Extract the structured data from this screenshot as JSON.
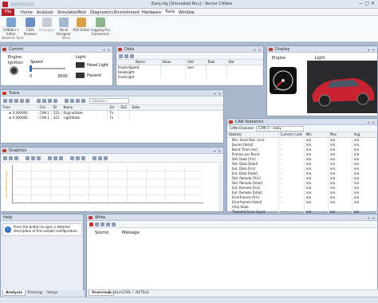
{
  "window": {
    "title": "Easy.cfg [Simulated Bus] - Vector CANoe"
  },
  "menu": {
    "file": "File",
    "items": [
      "Home",
      "Analysis",
      "Simulation",
      "Test",
      "Diagnostics",
      "Environment",
      "Hardware",
      "Tools",
      "Window"
    ]
  },
  "ribbon": {
    "buttons": [
      "CANdb++ Editor",
      "CAPL Browser",
      "Debugger",
      "Panel Designer",
      "PDX Editor",
      "Logging File Conversion"
    ],
    "groups": [
      "Network Tools",
      "More"
    ]
  },
  "control": {
    "title": "Control",
    "engine": "Engine",
    "speed": "Speed",
    "ignition": "Ignition",
    "light": "Light",
    "speed_value": "0",
    "speed_max": "3000",
    "headlight": "Head Light",
    "hazard": "Hazard"
  },
  "data": {
    "title": "Data",
    "columns": [
      "Name",
      "Value",
      "Unit",
      "Raw",
      "Bar"
    ],
    "rows": [
      {
        "name": "EngineSpeed",
        "value": "",
        "unit": "rpm",
        "raw": ""
      },
      {
        "name": "HeadLight",
        "value": "",
        "unit": "",
        "raw": ""
      },
      {
        "name": "FlashLight",
        "value": "",
        "unit": "",
        "raw": ""
      }
    ]
  },
  "display": {
    "title": "Display",
    "engine": "Engine",
    "light": "Light",
    "gauge_unit": "x1000 rpm"
  },
  "trace": {
    "title": "Trace",
    "search_placeholder": "<Search>",
    "columns": [
      "Time",
      "Chn",
      "ID",
      "Name",
      "Dir",
      "DLC",
      "Data"
    ],
    "rows": [
      {
        "time": "0.000000",
        "chn": "CAN 1",
        "id": "123",
        "name": "EngineState",
        "dir": "Tx"
      },
      {
        "time": "0.000000",
        "chn": "CAN 1",
        "id": "321",
        "name": "LightState",
        "dir": "Tx"
      }
    ]
  },
  "graphics": {
    "title": "Graphics",
    "ylabel": "EngineSpeed [rpm]"
  },
  "can_stats": {
    "title": "CAN Statistics",
    "channel_label": "CAN Channel:",
    "channel_value": "CAN 1 - easy",
    "columns": [
      "Statistic",
      "Current / Last",
      "Min",
      "Max",
      "Avg"
    ],
    "rows": [
      [
        "Min. Send Dist. [ms]",
        "-",
        "n/a",
        "n/a",
        "n/a"
      ],
      [
        "Bursts [total]",
        "-",
        "n/a",
        "n/a",
        "n/a"
      ],
      [
        "Burst Time [ms]",
        "-",
        "n/a",
        "n/a",
        "n/a"
      ],
      [
        "Frames per Burst",
        "-",
        "n/a",
        "n/a",
        "n/a"
      ],
      [
        "Std. Data [fr/s]",
        "-",
        "n/a",
        "n/a",
        "n/a"
      ],
      [
        "Std. Data [total]",
        "-",
        "n/a",
        "n/a",
        "n/a"
      ],
      [
        "Ext. Data [fr/s]",
        "-",
        "n/a",
        "n/a",
        "n/a"
      ],
      [
        "Ext. Data [total]",
        "-",
        "n/a",
        "n/a",
        "n/a"
      ],
      [
        "Std. Remote [fr/s]",
        "-",
        "n/a",
        "n/a",
        "n/a"
      ],
      [
        "Std. Remote [total]",
        "-",
        "n/a",
        "n/a",
        "n/a"
      ],
      [
        "Ext. Remote [fr/s]",
        "-",
        "n/a",
        "n/a",
        "n/a"
      ],
      [
        "Ext. Remote [total]",
        "-",
        "n/a",
        "n/a",
        "n/a"
      ],
      [
        "Errorframes [fr/s]",
        "-",
        "n/a",
        "n/a",
        "n/a"
      ],
      [
        "Errorframes [total]",
        "-",
        "n/a",
        "n/a",
        "n/a"
      ],
      [
        "Chip State",
        "",
        "",
        "",
        ""
      ],
      [
        "Transmit Error Count",
        "-",
        "n/a",
        "n/a",
        "n/a"
      ],
      [
        "Receive Error Count",
        "",
        "",
        "",
        ""
      ]
    ]
  },
  "help": {
    "title": "Help",
    "text": "Press the button to open a detailed description of this sample configuration."
  },
  "write": {
    "title": "Write",
    "columns": [
      "Source",
      "Message"
    ],
    "tabs": [
      "Overview",
      "System",
      "CAPL / .NET",
      "Test"
    ]
  },
  "bottom_tabs": [
    "Analysis",
    "Tracking",
    "Setup"
  ]
}
